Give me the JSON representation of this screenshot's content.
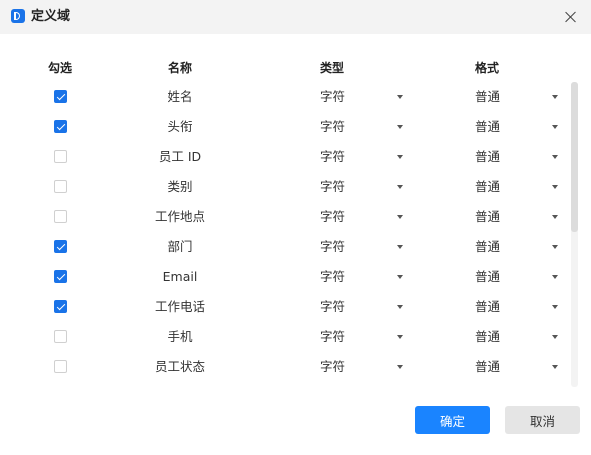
{
  "dialog": {
    "title": "定义域",
    "ok_label": "确定",
    "cancel_label": "取消"
  },
  "columns": {
    "select": "勾选",
    "name": "名称",
    "type": "类型",
    "format": "格式"
  },
  "rows": [
    {
      "checked": true,
      "name": "姓名",
      "type": "字符",
      "format": "普通"
    },
    {
      "checked": true,
      "name": "头衔",
      "type": "字符",
      "format": "普通"
    },
    {
      "checked": false,
      "name": "员工 ID",
      "type": "字符",
      "format": "普通"
    },
    {
      "checked": false,
      "name": "类别",
      "type": "字符",
      "format": "普通"
    },
    {
      "checked": false,
      "name": "工作地点",
      "type": "字符",
      "format": "普通"
    },
    {
      "checked": true,
      "name": "部门",
      "type": "字符",
      "format": "普通"
    },
    {
      "checked": true,
      "name": "Email",
      "type": "字符",
      "format": "普通"
    },
    {
      "checked": true,
      "name": "工作电话",
      "type": "字符",
      "format": "普通"
    },
    {
      "checked": false,
      "name": "手机",
      "type": "字符",
      "format": "普通"
    },
    {
      "checked": false,
      "name": "员工状态",
      "type": "字符",
      "format": "普通"
    }
  ],
  "colors": {
    "accent": "#1a84ff",
    "checkbox_checked": "#1a73e8",
    "titlebar": "#f3f3f3"
  }
}
